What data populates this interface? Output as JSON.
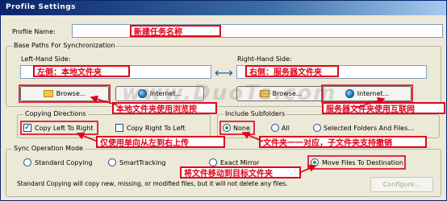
{
  "window": {
    "title": "Profile Settings"
  },
  "profile_name": {
    "label": "Profile Name:",
    "value": ""
  },
  "base_paths": {
    "group_label": "Base Paths For Synchronization",
    "left_label": "Left-Hand Side:",
    "right_label": "Right-Hand Side:",
    "left_value": "",
    "right_value": "",
    "swap_symbol": "⟷",
    "browse_left": "Browse...",
    "internet_left": "Internet...",
    "browse_right": "Browse...",
    "internet_right": "Internet..."
  },
  "copying": {
    "group_label": "Copying Directions",
    "left_to_right": {
      "label": "Copy Left To Right",
      "checked": true
    },
    "right_to_left": {
      "label": "Copy Right To Left",
      "checked": false
    }
  },
  "subfolders": {
    "group_label": "Include Subfolders",
    "options": [
      "None",
      "All",
      "Selected Folders And Files..."
    ],
    "selected": "None"
  },
  "sync_mode": {
    "group_label": "Sync Operation Mode",
    "options": [
      "Standard Copying",
      "SmartTracking",
      "Exact Mirror",
      "Move Files To Destination"
    ],
    "selected": "Move Files To Destination",
    "description": "Standard Copying will copy new, missing, or modified files, but it will not delete any files.",
    "configure_label": "Configure..."
  },
  "annotations": {
    "task_name": "新建任务名称",
    "left_folder": "左侧：本地文件夹",
    "right_folder": "右侧：服务器文件夹",
    "browse_note": "本地文件夹使用浏览按",
    "internet_note": "服务器文件夹使用互联网",
    "direction_note": "仅使用单向从左到右上传",
    "subfolder_note": "文件夹一一对应，子文件夹支持撤销",
    "move_note": "将文件移动到目标文件夹"
  },
  "watermark": "www.DuoTe.com",
  "colors": {
    "annotation": "#E0001B",
    "titlebar": "#0A246A",
    "dialog_bg": "#ECE9D8"
  }
}
